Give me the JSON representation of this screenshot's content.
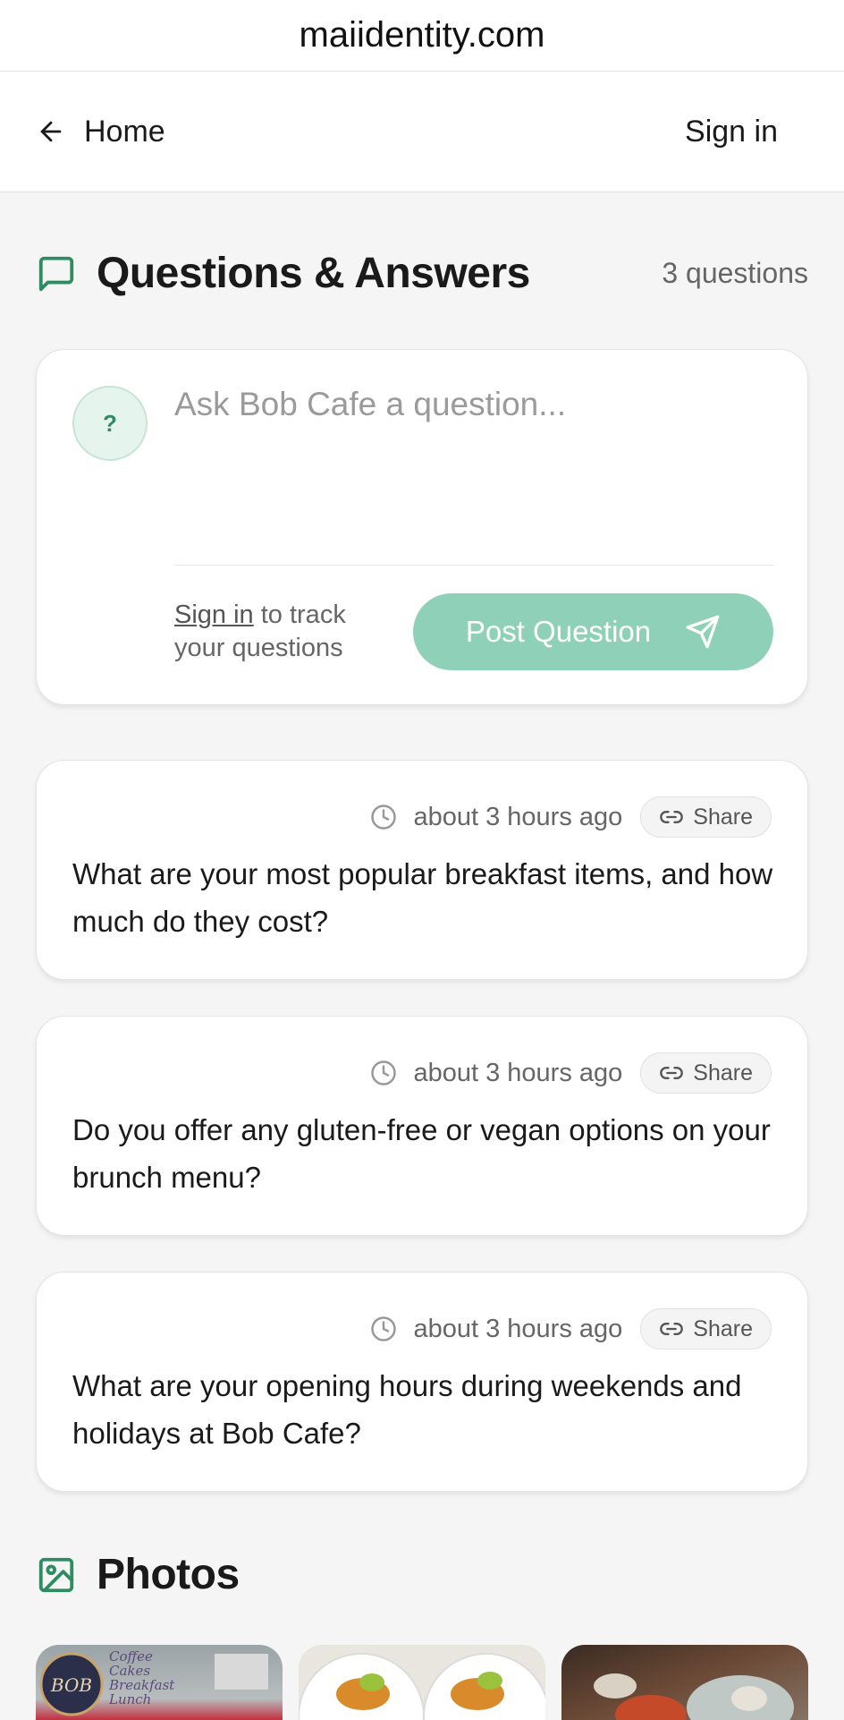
{
  "browser": {
    "url": "maiidentity.com"
  },
  "nav": {
    "home_label": "Home",
    "signin_label": "Sign in"
  },
  "qa": {
    "title": "Questions & Answers",
    "count": "3 questions",
    "icon": "message-square-icon",
    "ask": {
      "placeholder": "Ask Bob Cafe a question...",
      "avatar_symbol": "?",
      "signin_link": "Sign in",
      "track_text": " to track your questions",
      "post_label": "Post Question"
    },
    "questions": [
      {
        "time": "about 3 hours ago",
        "share_label": "Share",
        "text": "What are your most popular breakfast items, and how much do they cost?"
      },
      {
        "time": "about 3 hours ago",
        "share_label": "Share",
        "text": "Do you offer any gluten-free or vegan options on your brunch menu?"
      },
      {
        "time": "about 3 hours ago",
        "share_label": "Share",
        "text": "What are your opening hours during weekends and holidays at Bob Cafe?"
      }
    ]
  },
  "photos": {
    "title": "Photos",
    "icon": "image-icon",
    "logo_text": [
      "BOB",
      "Coffee",
      "Cakes",
      "Breakfast",
      "Lunch"
    ]
  },
  "colors": {
    "accent": "#2e8b62",
    "button": "#8fd1b8"
  }
}
